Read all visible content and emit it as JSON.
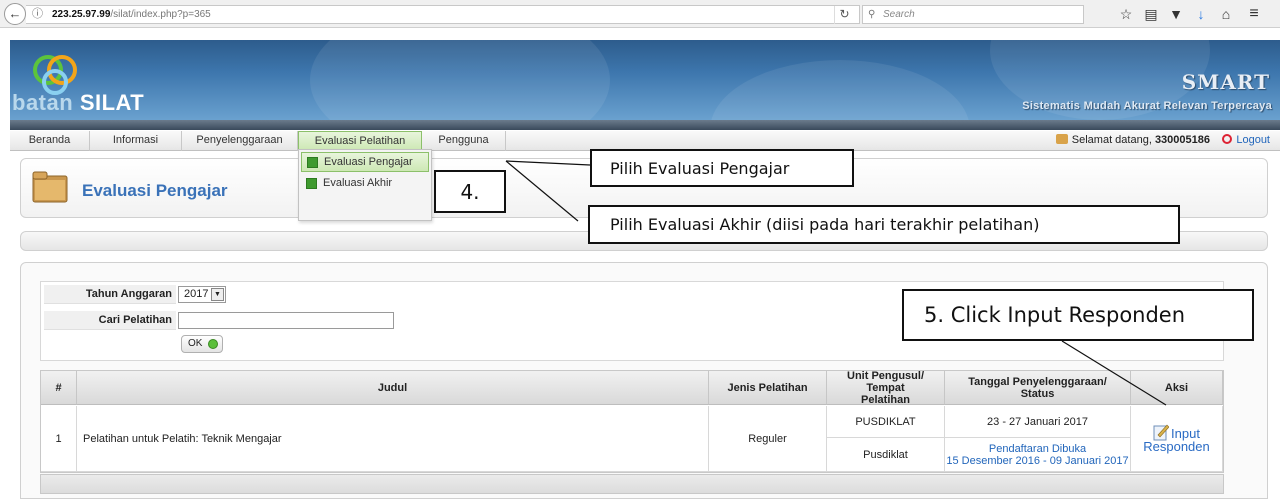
{
  "browser": {
    "url_host": "223.25.97.99",
    "url_path": "/silat/index.php?p=365",
    "search_placeholder": "Search"
  },
  "header": {
    "brand_part1": "batan",
    "brand_part2": "SILAT",
    "smart_title": "SMART",
    "smart_subtitle": "Sistematis Mudah Akurat Relevan Terpercaya"
  },
  "nav": {
    "items": [
      "Beranda",
      "Informasi",
      "Penyelenggaraan",
      "Evaluasi Pelatihan",
      "Pengguna"
    ],
    "welcome_prefix": "Selamat datang, ",
    "user_id": "330005186",
    "logout": "Logout"
  },
  "dropdown": {
    "items": [
      "Evaluasi Pengajar",
      "Evaluasi Akhir"
    ]
  },
  "page": {
    "title": "Evaluasi Pengajar"
  },
  "filter": {
    "year_label": "Tahun Anggaran",
    "year_value": "2017",
    "search_label": "Cari Pelatihan",
    "search_value": "",
    "ok_label": "OK"
  },
  "table": {
    "headers": [
      "#",
      "Judul",
      "Jenis Pelatihan",
      "Unit Pengusul/ Tempat Pelatihan",
      "Tanggal Penyelenggaraan/ Status",
      "Aksi"
    ],
    "rows": [
      {
        "no": "1",
        "title": "Pelatihan untuk Pelatih: Teknik Mengajar",
        "type": "Reguler",
        "unit": "PUSDIKLAT",
        "place": "Pusdiklat",
        "date": "23 - 27 Januari 2017",
        "status_line1": "Pendaftaran Dibuka",
        "status_line2": "15 Desember 2016 - 09 Januari 2017",
        "action": "Input Responden"
      }
    ]
  },
  "annotations": {
    "step4": "4.",
    "pengajar": "Pilih Evaluasi Pengajar",
    "akhir": "Pilih Evaluasi Akhir (diisi pada hari terakhir pelatihan)",
    "step5": "5. Click Input Responden"
  }
}
